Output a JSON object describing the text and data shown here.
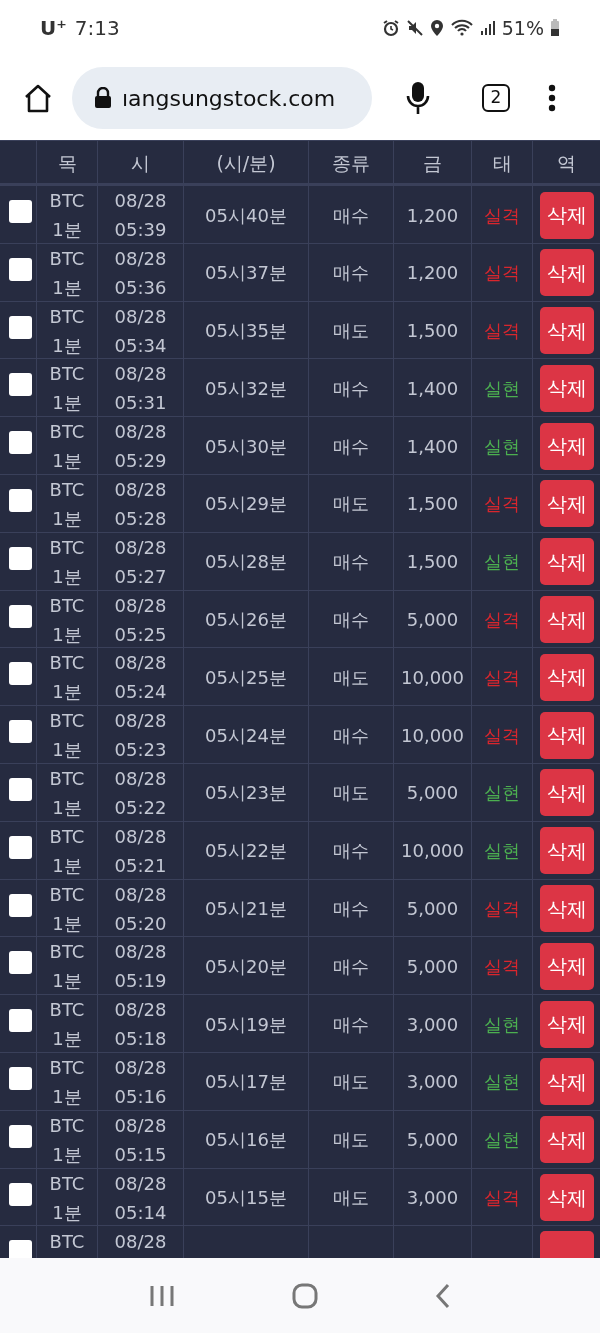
{
  "status_bar": {
    "carrier": "U⁺",
    "time": "7:13",
    "battery": "51%"
  },
  "browser": {
    "url": "ıangsungstock.com",
    "tab_count": "2"
  },
  "table": {
    "columns": [
      "목",
      "시",
      "(시/분)",
      "종류",
      "금",
      "태",
      "역"
    ],
    "rows": [
      {
        "checked": false,
        "symbol": [
          "BTC",
          "1분"
        ],
        "date": [
          "08/28",
          "05:39"
        ],
        "result_time": "05시40분",
        "type": "매수",
        "amount": "1,200",
        "status": "실격",
        "color": "#d9262d",
        "action": "삭제"
      },
      {
        "checked": false,
        "symbol": [
          "BTC",
          "1분"
        ],
        "date": [
          "08/28",
          "05:36"
        ],
        "result_time": "05시37분",
        "type": "매수",
        "amount": "1,200",
        "status": "실격",
        "color": "#d9262d",
        "action": "삭제"
      },
      {
        "checked": false,
        "symbol": [
          "BTC",
          "1분"
        ],
        "date": [
          "08/28",
          "05:34"
        ],
        "result_time": "05시35분",
        "type": "매도",
        "amount": "1,500",
        "status": "실격",
        "color": "#d9262d",
        "action": "삭제"
      },
      {
        "checked": false,
        "symbol": [
          "BTC",
          "1분"
        ],
        "date": [
          "08/28",
          "05:31"
        ],
        "result_time": "05시32분",
        "type": "매수",
        "amount": "1,400",
        "status": "실현",
        "color": "#4caf50",
        "action": "삭제"
      },
      {
        "checked": false,
        "symbol": [
          "BTC",
          "1분"
        ],
        "date": [
          "08/28",
          "05:29"
        ],
        "result_time": "05시30분",
        "type": "매수",
        "amount": "1,400",
        "status": "실현",
        "color": "#4caf50",
        "action": "삭제"
      },
      {
        "checked": false,
        "symbol": [
          "BTC",
          "1분"
        ],
        "date": [
          "08/28",
          "05:28"
        ],
        "result_time": "05시29분",
        "type": "매도",
        "amount": "1,500",
        "status": "실격",
        "color": "#d9262d",
        "action": "삭제"
      },
      {
        "checked": false,
        "symbol": [
          "BTC",
          "1분"
        ],
        "date": [
          "08/28",
          "05:27"
        ],
        "result_time": "05시28분",
        "type": "매수",
        "amount": "1,500",
        "status": "실현",
        "color": "#4caf50",
        "action": "삭제"
      },
      {
        "checked": false,
        "symbol": [
          "BTC",
          "1분"
        ],
        "date": [
          "08/28",
          "05:25"
        ],
        "result_time": "05시26분",
        "type": "매수",
        "amount": "5,000",
        "status": "실격",
        "color": "#d9262d",
        "action": "삭제"
      },
      {
        "checked": false,
        "symbol": [
          "BTC",
          "1분"
        ],
        "date": [
          "08/28",
          "05:24"
        ],
        "result_time": "05시25분",
        "type": "매도",
        "amount": "10,000",
        "status": "실격",
        "color": "#d9262d",
        "action": "삭제"
      },
      {
        "checked": false,
        "symbol": [
          "BTC",
          "1분"
        ],
        "date": [
          "08/28",
          "05:23"
        ],
        "result_time": "05시24분",
        "type": "매수",
        "amount": "10,000",
        "status": "실격",
        "color": "#d9262d",
        "action": "삭제"
      },
      {
        "checked": false,
        "symbol": [
          "BTC",
          "1분"
        ],
        "date": [
          "08/28",
          "05:22"
        ],
        "result_time": "05시23분",
        "type": "매도",
        "amount": "5,000",
        "status": "실현",
        "color": "#4caf50",
        "action": "삭제"
      },
      {
        "checked": false,
        "symbol": [
          "BTC",
          "1분"
        ],
        "date": [
          "08/28",
          "05:21"
        ],
        "result_time": "05시22분",
        "type": "매수",
        "amount": "10,000",
        "status": "실현",
        "color": "#4caf50",
        "action": "삭제"
      },
      {
        "checked": false,
        "symbol": [
          "BTC",
          "1분"
        ],
        "date": [
          "08/28",
          "05:20"
        ],
        "result_time": "05시21분",
        "type": "매수",
        "amount": "5,000",
        "status": "실격",
        "color": "#d9262d",
        "action": "삭제"
      },
      {
        "checked": false,
        "symbol": [
          "BTC",
          "1분"
        ],
        "date": [
          "08/28",
          "05:19"
        ],
        "result_time": "05시20분",
        "type": "매수",
        "amount": "5,000",
        "status": "실격",
        "color": "#d9262d",
        "action": "삭제"
      },
      {
        "checked": false,
        "symbol": [
          "BTC",
          "1분"
        ],
        "date": [
          "08/28",
          "05:18"
        ],
        "result_time": "05시19분",
        "type": "매수",
        "amount": "3,000",
        "status": "실현",
        "color": "#4caf50",
        "action": "삭제"
      },
      {
        "checked": false,
        "symbol": [
          "BTC",
          "1분"
        ],
        "date": [
          "08/28",
          "05:16"
        ],
        "result_time": "05시17분",
        "type": "매도",
        "amount": "3,000",
        "status": "실현",
        "color": "#4caf50",
        "action": "삭제"
      },
      {
        "checked": false,
        "symbol": [
          "BTC",
          "1분"
        ],
        "date": [
          "08/28",
          "05:15"
        ],
        "result_time": "05시16분",
        "type": "매도",
        "amount": "5,000",
        "status": "실현",
        "color": "#4caf50",
        "action": "삭제"
      },
      {
        "checked": false,
        "symbol": [
          "BTC",
          "1분"
        ],
        "date": [
          "08/28",
          "05:14"
        ],
        "result_time": "05시15분",
        "type": "매도",
        "amount": "3,000",
        "status": "실격",
        "color": "#d9262d",
        "action": "삭제"
      },
      {
        "checked": false,
        "symbol": [
          "BTC"
        ],
        "date": [
          "08/28"
        ]
      }
    ]
  }
}
